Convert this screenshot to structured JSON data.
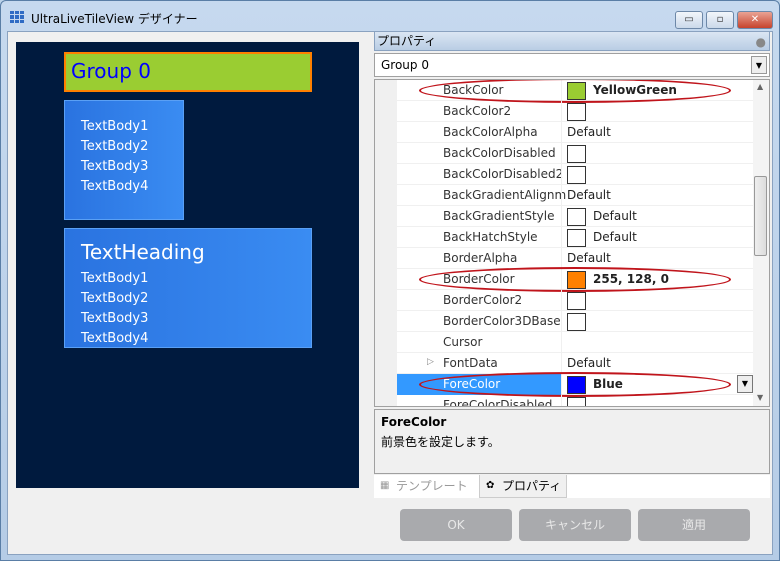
{
  "window": {
    "title": "UltraLiveTileView デザイナー",
    "minimize": "▭",
    "maximize": "▫",
    "close": "✕"
  },
  "preview": {
    "group_header": "Group 0",
    "tile1": {
      "bodies": [
        "TextBody1",
        "TextBody2",
        "TextBody3",
        "TextBody4"
      ]
    },
    "tile2": {
      "heading": "TextHeading",
      "bodies": [
        "TextBody1",
        "TextBody2",
        "TextBody3",
        "TextBody4"
      ]
    }
  },
  "properties": {
    "header": "プロパティ",
    "object_selector": "Group 0",
    "rows": [
      {
        "name": "BackColor",
        "swatch": "#9acd32",
        "value": "YellowGreen",
        "bold": true,
        "highlighted": true
      },
      {
        "name": "BackColor2",
        "swatch": "#ffffff",
        "value": ""
      },
      {
        "name": "BackColorAlpha",
        "value": "Default"
      },
      {
        "name": "BackColorDisabled",
        "swatch": "#ffffff",
        "value": ""
      },
      {
        "name": "BackColorDisabled2",
        "swatch": "#ffffff",
        "value": ""
      },
      {
        "name": "BackGradientAlignm",
        "value": "Default"
      },
      {
        "name": "BackGradientStyle",
        "swatch": "#ffffff",
        "value": "Default"
      },
      {
        "name": "BackHatchStyle",
        "swatch": "#ffffff",
        "value": "Default"
      },
      {
        "name": "BorderAlpha",
        "value": "Default"
      },
      {
        "name": "BorderColor",
        "swatch": "#ff8000",
        "value": "255, 128, 0",
        "bold": true,
        "highlighted": true
      },
      {
        "name": "BorderColor2",
        "swatch": "#ffffff",
        "value": ""
      },
      {
        "name": "BorderColor3DBase",
        "swatch": "#ffffff",
        "value": ""
      },
      {
        "name": "Cursor",
        "value": ""
      },
      {
        "name": "FontData",
        "value": "Default",
        "expandable": true
      },
      {
        "name": "ForeColor",
        "swatch": "#0000ff",
        "value": "Blue",
        "bold": true,
        "highlighted": true,
        "selected": true
      },
      {
        "name": "ForeColorDisabled",
        "swatch": "#ffffff",
        "value": ""
      }
    ],
    "description": {
      "title": "ForeColor",
      "text": "前景色を設定します。"
    }
  },
  "tabs": [
    {
      "label": "テンプレート",
      "active": false
    },
    {
      "label": "プロパティ",
      "active": true
    }
  ],
  "buttons": {
    "ok": "OK",
    "cancel": "キャンセル",
    "apply": "適用"
  }
}
